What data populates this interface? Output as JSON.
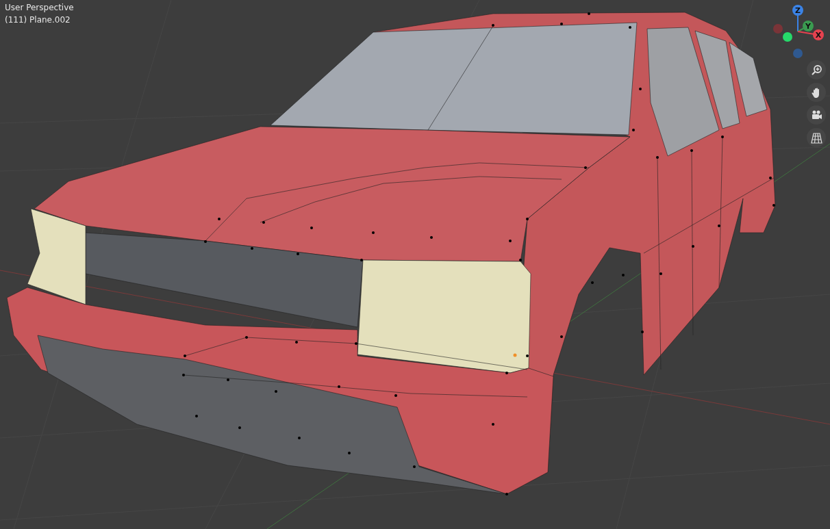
{
  "viewport": {
    "view_label": "User Perspective",
    "object_label": "(111) Plane.002"
  },
  "gizmo": {
    "axes": [
      {
        "kind": "positive",
        "label": "Z",
        "color": "#3b83e6"
      },
      {
        "kind": "positive",
        "label": "Y",
        "color": "#3a9b50"
      },
      {
        "kind": "positive",
        "label": "X",
        "color": "#e6424f"
      },
      {
        "kind": "negative",
        "color": "#7a3438"
      },
      {
        "kind": "negative",
        "color": "#26d96a"
      },
      {
        "kind": "negative",
        "color": "#2f5990"
      }
    ]
  },
  "nav_tools": [
    {
      "kind": "zoom"
    },
    {
      "kind": "pan"
    },
    {
      "kind": "camera"
    },
    {
      "kind": "ortho"
    }
  ]
}
